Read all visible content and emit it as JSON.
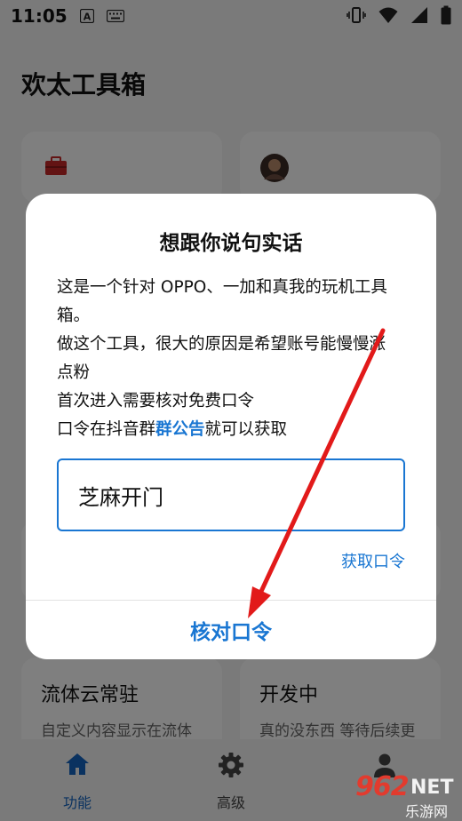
{
  "status_bar": {
    "time": "11:05"
  },
  "app": {
    "title": "欢太工具箱"
  },
  "cards": [
    {
      "title": "流体云常驻",
      "desc": "自定义内容显示在流体"
    },
    {
      "title": "开发中",
      "desc": "真的没东西 等待后续更"
    }
  ],
  "bottom_nav": [
    {
      "label": "功能",
      "icon": "home-icon",
      "active": true
    },
    {
      "label": "高级",
      "icon": "gear-icon",
      "active": false
    },
    {
      "label": "",
      "icon": "person-icon",
      "active": false
    }
  ],
  "dialog": {
    "title": "想跟你说句实话",
    "line1": "这是一个针对 OPPO、一加和真我的玩机工具",
    "line2": "箱。",
    "line3": "做这个工具，很大的原因是希望账号能慢慢涨",
    "line4": "点粉",
    "line5": "首次进入需要核对免费口令",
    "line6_prefix": "口令在抖音群",
    "line6_link": "群公告",
    "line6_suffix": "就可以获取",
    "input_value": "芝麻开门",
    "get_code": "获取口令",
    "verify": "核对口令"
  },
  "watermark": {
    "number": "962",
    "net": "NET",
    "sub": "乐游网"
  },
  "colors": {
    "accent": "#1976d2",
    "arrow": "#e21a1a"
  }
}
